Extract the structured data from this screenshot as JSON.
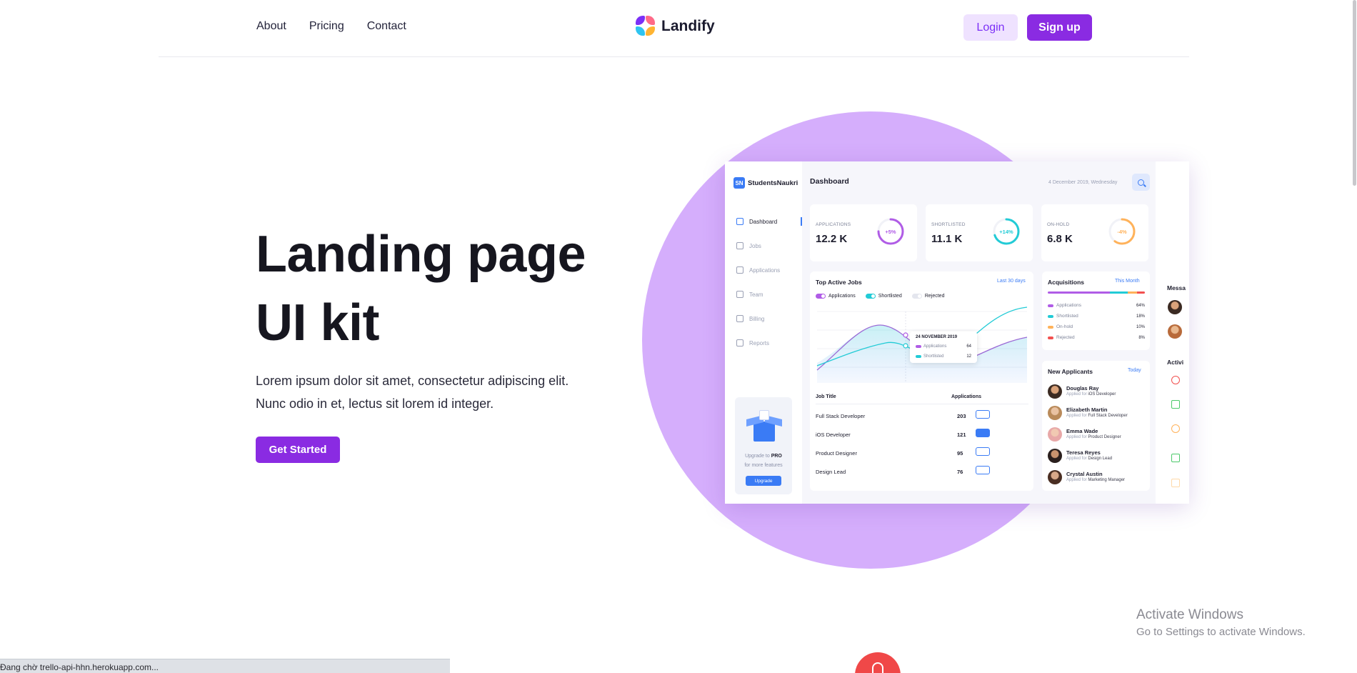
{
  "nav": {
    "links": [
      "About",
      "Pricing",
      "Contact"
    ],
    "brand": "Landify",
    "login_label": "Login",
    "signup_label": "Sign up"
  },
  "hero": {
    "title_line1": "Landing page",
    "title_line2": "UI kit",
    "desc_line1": "Lorem ipsum dolor sit amet, consectetur adipiscing elit.",
    "desc_line2": "Nunc odio in et, lectus sit lorem id integer.",
    "cta_label": "Get Started"
  },
  "dashboard": {
    "brand_badge": "SN",
    "brand_name": "StudentsNaukri",
    "title": "Dashboard",
    "date": "4 December 2019, Wednesday",
    "menu": [
      "Dashboard",
      "Jobs",
      "Applications",
      "Team",
      "Billing",
      "Reports"
    ],
    "upgrade": {
      "line1_pre": "Upgrade to ",
      "line1_bold": "PRO",
      "line2": "for more features",
      "button": "Upgrade"
    },
    "stats": [
      {
        "label": "APPLICATIONS",
        "value": "12.2 K",
        "pct": "+5%",
        "fraction": 0.75,
        "color": "#b05ce6"
      },
      {
        "label": "SHORTLISTED",
        "value": "11.1 K",
        "pct": "+14%",
        "fraction": 0.7,
        "color": "#22cbd6"
      },
      {
        "label": "ON-HOLD",
        "value": "6.8 K",
        "pct": "-4%",
        "fraction": 0.6,
        "color": "#ffb25a"
      }
    ],
    "top_jobs": {
      "title": "Top Active Jobs",
      "link": "Last 30 days",
      "legend": [
        {
          "label": "Applications",
          "color": "#b05ce6"
        },
        {
          "label": "Shortlisted",
          "color": "#22cbd6"
        },
        {
          "label": "Rejected",
          "color": "#e4e6ee"
        }
      ],
      "tooltip": {
        "date": "24 NOVEMBER 2019",
        "rows": [
          {
            "label": "Applications",
            "value": "64"
          },
          {
            "label": "Shortlisted",
            "value": "12"
          }
        ]
      },
      "columns": [
        "Job Title",
        "Applications"
      ],
      "rows": [
        {
          "title": "Full Stack Developer",
          "count": "203"
        },
        {
          "title": "iOS Developer",
          "count": "121"
        },
        {
          "title": "Product Designer",
          "count": "95"
        },
        {
          "title": "Design Lead",
          "count": "76"
        }
      ]
    },
    "acquisitions": {
      "title": "Acquisitions",
      "link": "This Month",
      "rows": [
        {
          "label": "Applications",
          "value": "64%",
          "color": "#b05ce6"
        },
        {
          "label": "Shortlisted",
          "value": "18%",
          "color": "#22cbd6"
        },
        {
          "label": "On-hold",
          "value": "10%",
          "color": "#ffb25a"
        },
        {
          "label": "Rejected",
          "value": "8%",
          "color": "#f2504f"
        }
      ]
    },
    "new_applicants": {
      "title": "New Applicants",
      "link": "Today",
      "applied_prefix": "Applied for ",
      "rows": [
        {
          "name": "Douglas Ray",
          "role": "iOS Developer"
        },
        {
          "name": "Elizabeth Martin",
          "role": "Full Stack Developer"
        },
        {
          "name": "Emma Wade",
          "role": "Product Designer"
        },
        {
          "name": "Teresa Reyes",
          "role": "Design Lead"
        },
        {
          "name": "Crystal Austin",
          "role": "Marketing Manager"
        }
      ]
    },
    "right": {
      "messages_title": "Messa",
      "activity_title": "Activi"
    }
  },
  "watermark": {
    "line1": "Activate Windows",
    "line2": "Go to Settings to activate Windows."
  },
  "status_bar": "Đang chờ trello-api-hhn.herokuapp.com..."
}
